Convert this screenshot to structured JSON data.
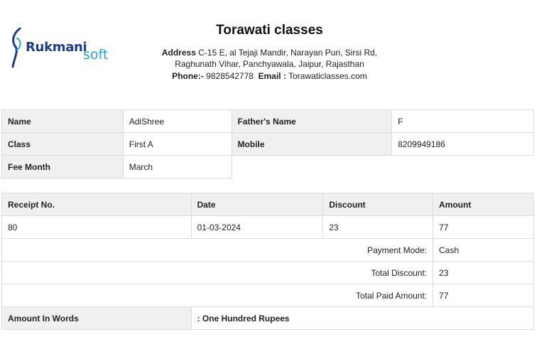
{
  "logo": {
    "brand_main": "Rukmani",
    "brand_sub": "soft"
  },
  "header": {
    "school_name": "Torawati classes",
    "address_label": "Address",
    "address_line1": "C-15 E, al Tejaji Mandir, Narayan Puri, Sirsi Rd,",
    "address_line2": "Raghunath Vihar, Panchyawala, Jaipur, Rajasthan",
    "phone_label": "Phone:-",
    "phone": "9828542778",
    "email_label": "Email :",
    "email": "Torawaticlasses.com"
  },
  "student": {
    "name_label": "Name",
    "name": "AdiShree",
    "father_label": "Father's Name",
    "father": "F",
    "class_label": "Class",
    "class": "First A",
    "mobile_label": "Mobile",
    "mobile": "8209949186",
    "fee_month_label": "Fee Month",
    "fee_month": "March"
  },
  "receipt": {
    "headers": {
      "receipt_no": "Receipt No.",
      "date": "Date",
      "discount": "Discount",
      "amount": "Amount"
    },
    "row": {
      "receipt_no": "80",
      "date": "01-03-2024",
      "discount": "23",
      "amount": "77"
    },
    "payment_mode_label": "Payment Mode:",
    "payment_mode": "Cash",
    "total_discount_label": "Total Discount:",
    "total_discount": "23",
    "total_paid_label": "Total Paid Amount:",
    "total_paid": "77",
    "amount_words_label": "Amount In Words",
    "amount_words": ": One Hundred Rupees"
  }
}
